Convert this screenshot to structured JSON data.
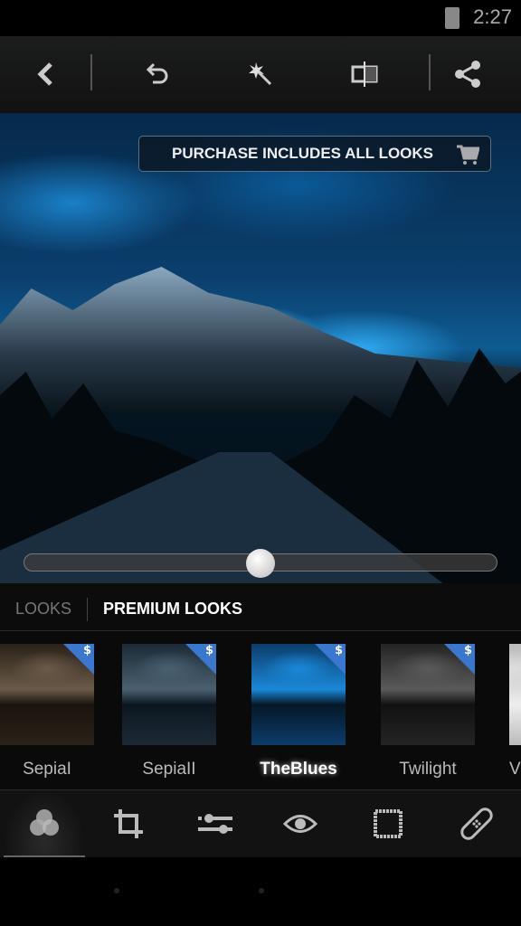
{
  "status_bar": {
    "time": "2:27",
    "battery_icon": "battery-charging-icon"
  },
  "toolbar": {
    "items": [
      "back-icon",
      "undo-icon",
      "auto-fix-wand-icon",
      "compare-icon",
      "share-icon"
    ]
  },
  "banner": {
    "text": "PURCHASE INCLUDES ALL LOOKS",
    "icon": "cart-icon"
  },
  "slider": {
    "value": 0.5
  },
  "tabs": {
    "looks": "LOOKS",
    "premium": "PREMIUM LOOKS",
    "active": "premium"
  },
  "looks": [
    {
      "label": "SepiaI",
      "premium": true,
      "selected": false
    },
    {
      "label": "SepiaII",
      "premium": true,
      "selected": false
    },
    {
      "label": "TheBlues",
      "premium": true,
      "selected": true
    },
    {
      "label": "Twilight",
      "premium": true,
      "selected": false
    },
    {
      "label": "V",
      "premium": false,
      "selected": false
    }
  ],
  "badge_symbol": "$",
  "tools": [
    "looks-icon",
    "crop-icon",
    "adjust-icon",
    "red-eye-icon",
    "frame-icon",
    "heal-icon"
  ],
  "colors": {
    "accent": "#3a78d0",
    "badge": "#3a78d0"
  }
}
